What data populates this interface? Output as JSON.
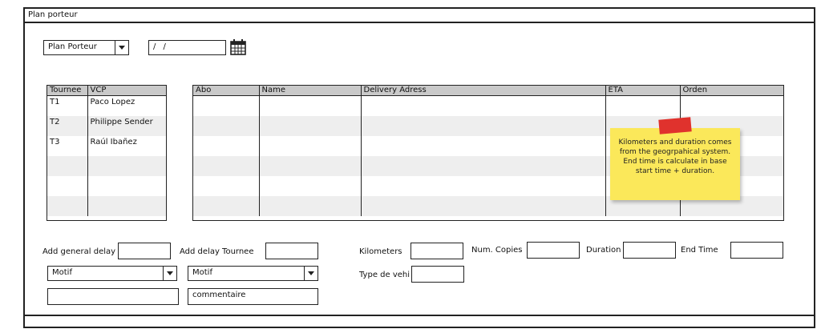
{
  "window": {
    "title": "Plan porteur"
  },
  "top_controls": {
    "view_select": "Plan Porteur",
    "date_field": "/ /",
    "calendar_icon": "calendar-icon"
  },
  "tournee_table": {
    "headers": [
      "Tournee",
      "VCP"
    ],
    "rows": [
      [
        "T1",
        "Paco Lopez"
      ],
      [
        "T2",
        "Philippe Sender"
      ],
      [
        "T3",
        "Raúl Ibañez"
      ],
      [
        "",
        ""
      ],
      [
        "",
        ""
      ],
      [
        "",
        ""
      ]
    ]
  },
  "delivery_table": {
    "headers": [
      "Abo",
      "Name",
      "Delivery Adress",
      "ETA",
      "Orden"
    ],
    "rows": [
      [
        "",
        "",
        "",
        "",
        ""
      ],
      [
        "",
        "",
        "",
        "",
        ""
      ],
      [
        "",
        "",
        "",
        "",
        ""
      ],
      [
        "",
        "",
        "",
        "",
        ""
      ],
      [
        "",
        "",
        "",
        "",
        ""
      ],
      [
        "",
        "",
        "",
        "",
        ""
      ]
    ]
  },
  "sticky_note": {
    "text": "Kilometers and duration comes from the geogrpahical system. End time is calculate in base start time + duration."
  },
  "form": {
    "add_general_delay_label": "Add general delay",
    "add_general_delay_value": "",
    "add_delay_tournee_label": "Add delay Tournee",
    "add_delay_tournee_value": "",
    "motif1": "Motif",
    "motif2": "Motif",
    "comment1": "",
    "comment2": "commentaire",
    "kilometers_label": "Kilometers",
    "kilometers_value": "",
    "num_copies_label": "Num. Copies",
    "num_copies_value": "",
    "duration_label": "Duration",
    "duration_value": "",
    "end_time_label": "End Time",
    "end_time_value": "",
    "type_vehicle_label": "Type de vehi",
    "type_vehicle_value": ""
  },
  "colors": {
    "header_bg": "#c9c9c9",
    "row_alt": "#eeeeee",
    "note": "#fbe85a",
    "pin": "#e0322d"
  }
}
